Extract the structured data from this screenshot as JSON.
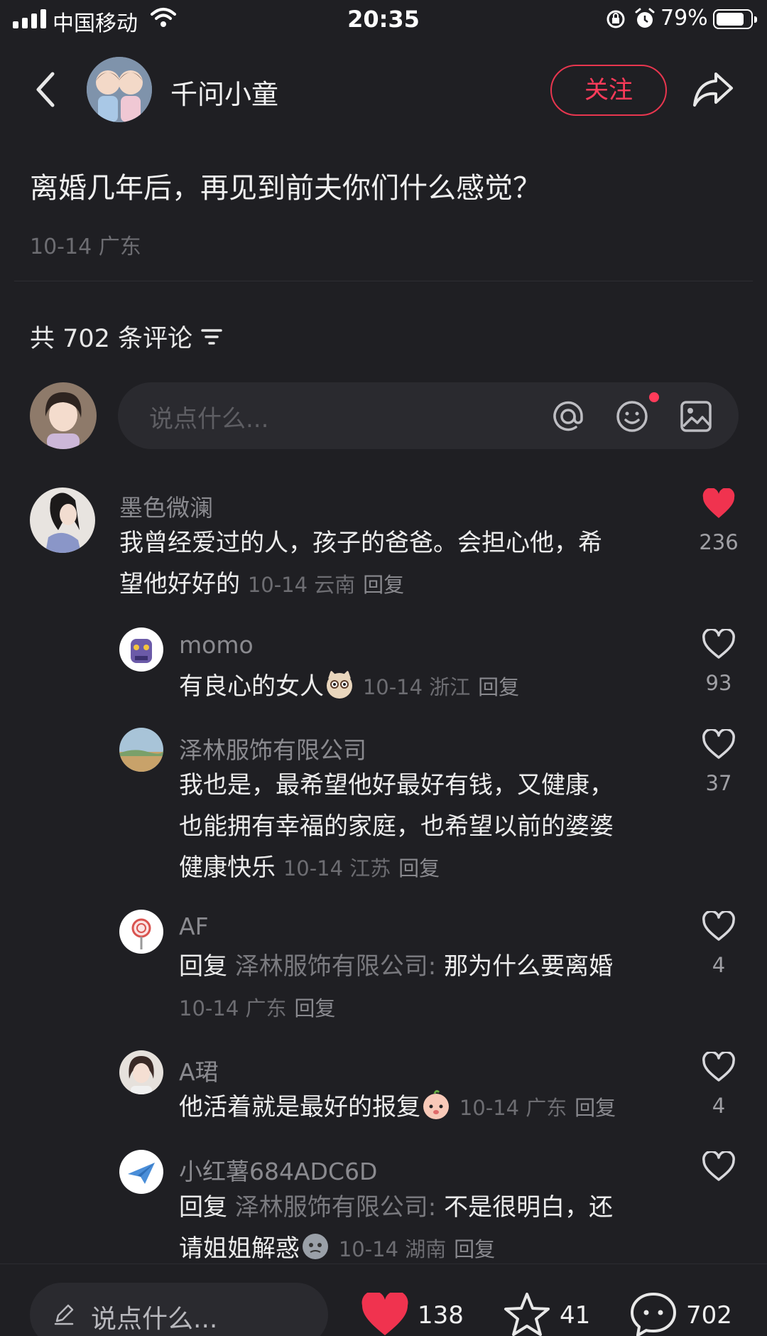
{
  "status_bar": {
    "carrier": "中国移动",
    "time": "20:35",
    "battery": "79%"
  },
  "header": {
    "author_name": "千问小童",
    "follow_label": "关注"
  },
  "post": {
    "title": "离婚几年后，再见到前夫你们什么感觉？",
    "meta": "10-14 广东"
  },
  "comments_header": {
    "count_label": "共 702 条评论"
  },
  "comment_input": {
    "placeholder": "说点什么..."
  },
  "comments": [
    {
      "user": "墨色微澜",
      "text_line1": "我曾经爱过的人，孩子的爸爸。会担心他，希",
      "text_line2": "望他好好的",
      "meta": "10-14 云南",
      "reply": "回复",
      "likes": "236",
      "liked": true,
      "replies": [
        {
          "user": "momo",
          "text": "有良心的女人",
          "meta": "10-14 浙江",
          "reply": "回复",
          "likes": "93"
        },
        {
          "user": "泽林服饰有限公司",
          "text_line1": "我也是，最希望他好最好有钱，又健康，",
          "text_line2": "也能拥有幸福的家庭，也希望以前的婆婆",
          "text_line3": "健康快乐",
          "meta": "10-14 江苏",
          "reply": "回复",
          "likes": "37"
        },
        {
          "user": "AF",
          "reply_prefix": "回复",
          "reply_to": "泽林服饰有限公司:",
          "text": "那为什么要离婚",
          "meta": "10-14 广东",
          "reply": "回复",
          "likes": "4"
        },
        {
          "user": "A珺",
          "text": "他活着就是最好的报复",
          "meta": "10-14 广东",
          "reply": "回复",
          "likes": "4"
        },
        {
          "user": "小红薯684ADC6D",
          "reply_prefix": "回复",
          "reply_to": "泽林服饰有限公司:",
          "text_line1": "不是很明白，还",
          "text_line2": "请姐姐解惑",
          "meta": "10-14 湖南",
          "reply": "回复"
        }
      ]
    }
  ],
  "bottom_bar": {
    "input_placeholder": "说点什么...",
    "likes": "138",
    "collects": "41",
    "comments": "702"
  },
  "colors": {
    "background": "#1f1f23",
    "accent": "#ff3b5a",
    "muted_text": "#6d6d72"
  }
}
